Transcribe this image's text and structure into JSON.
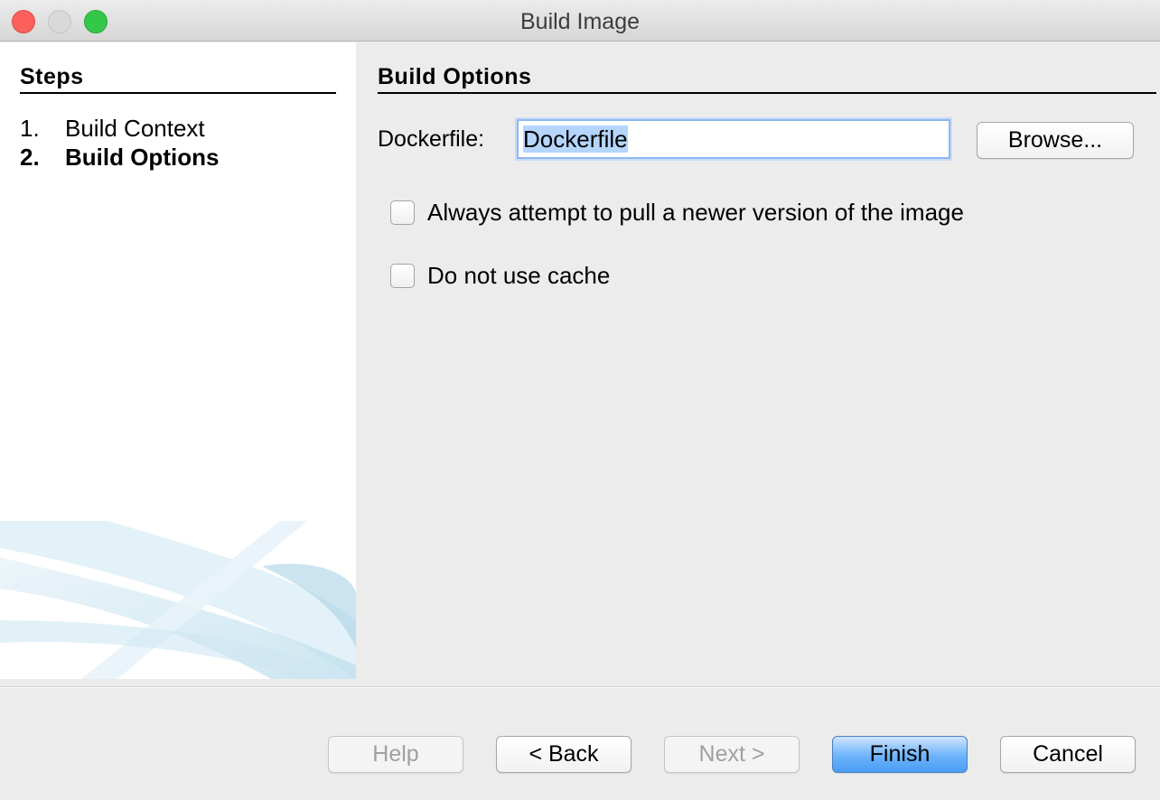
{
  "window": {
    "title": "Build Image"
  },
  "steps": {
    "heading": "Steps",
    "items": [
      {
        "num": "1.",
        "label": "Build Context",
        "current": false
      },
      {
        "num": "2.",
        "label": "Build Options",
        "current": true
      }
    ]
  },
  "main": {
    "heading": "Build Options",
    "dockerfile": {
      "label": "Dockerfile:",
      "value": "Dockerfile",
      "browse_label": "Browse..."
    },
    "options": [
      {
        "label": "Always attempt to pull a newer version of the image",
        "checked": false
      },
      {
        "label": "Do not use cache",
        "checked": false
      }
    ]
  },
  "footer": {
    "help_label": "Help",
    "back_label": "< Back",
    "next_label": "Next >",
    "finish_label": "Finish",
    "cancel_label": "Cancel"
  },
  "colors": {
    "accent": "#6cb3fa",
    "selection": "#b5d5fd"
  }
}
